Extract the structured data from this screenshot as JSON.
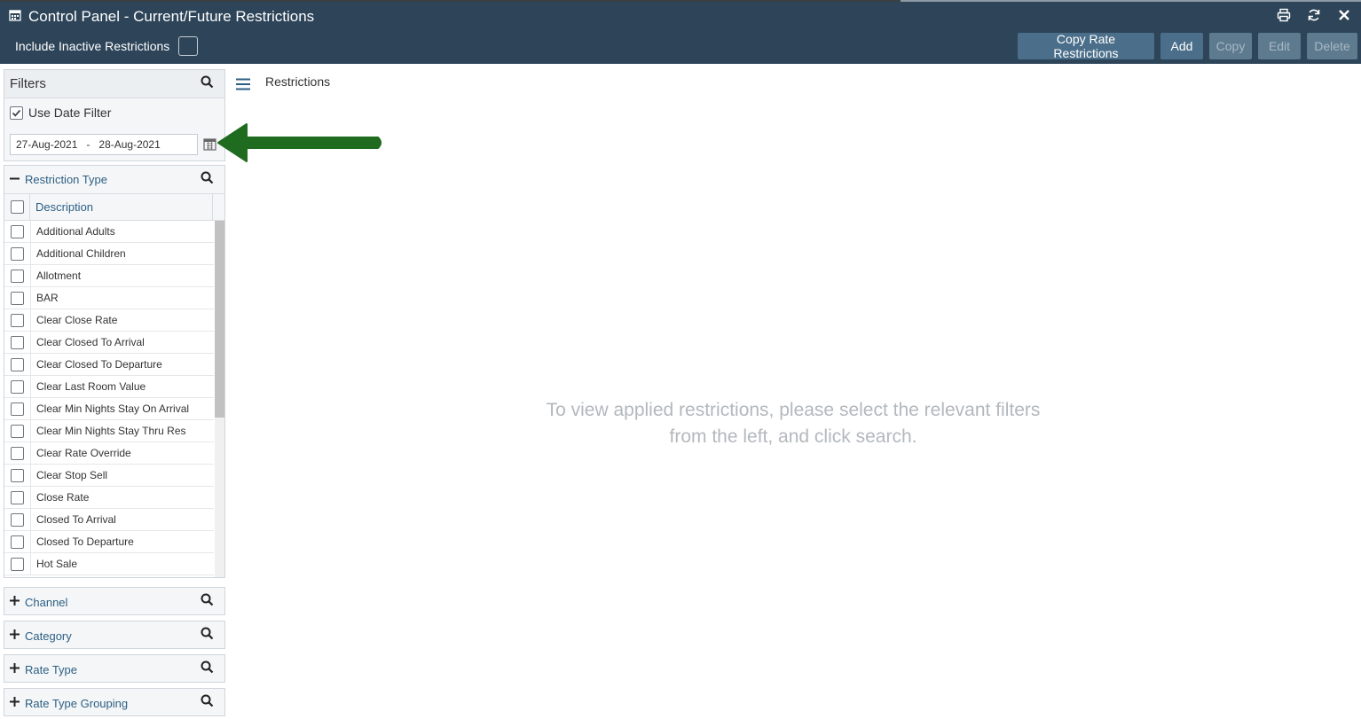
{
  "header": {
    "title": "Control Panel - Current/Future Restrictions",
    "title_icon": "calendar-icon",
    "actions": {
      "print_icon": "print-icon",
      "refresh_icon": "refresh-icon",
      "close_icon": "close-icon"
    },
    "include_inactive_label": "Include Inactive Restrictions",
    "buttons": {
      "copy_rate_restrictions": "Copy Rate Restrictions",
      "add": "Add",
      "copy": "Copy",
      "edit": "Edit",
      "delete": "Delete"
    }
  },
  "filters": {
    "title": "Filters",
    "use_date_filter_label": "Use Date Filter",
    "use_date_filter_checked": true,
    "date_from": "27-Aug-2021",
    "date_separator": "-",
    "date_to": "28-Aug-2021"
  },
  "restriction_type": {
    "title": "Restriction Type",
    "column_header": "Description",
    "items": [
      "Additional Adults",
      "Additional Children",
      "Allotment",
      "BAR",
      "Clear Close Rate",
      "Clear Closed To Arrival",
      "Clear Closed To Departure",
      "Clear Last Room Value",
      "Clear Min Nights Stay On Arrival",
      "Clear Min Nights Stay Thru Res",
      "Clear Rate Override",
      "Clear Stop Sell",
      "Close Rate",
      "Closed To Arrival",
      "Closed To Departure",
      "Hot Sale"
    ]
  },
  "collapsed_panels": {
    "channel": "Channel",
    "category": "Category",
    "rate_type": "Rate Type",
    "rate_type_grouping": "Rate Type Grouping"
  },
  "main": {
    "section_title": "Restrictions",
    "empty_line1": "To view applied restrictions, please select the relevant filters",
    "empty_line2": "from the left, and click search."
  },
  "colors": {
    "header_bg": "#2d4459",
    "button_bg": "#4b6f8a",
    "accent_blue": "#2d5f82",
    "arrow_green": "#1f6b1f"
  }
}
